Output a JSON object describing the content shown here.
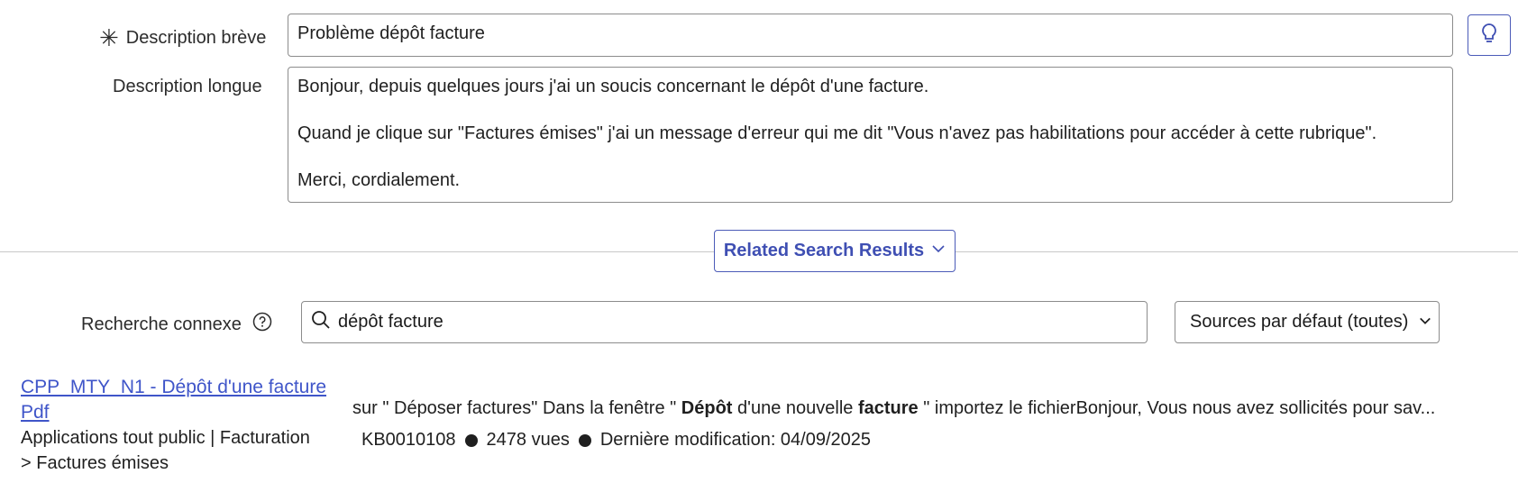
{
  "form": {
    "short_desc_label": "Description brève",
    "short_desc_value": "Problème dépôt facture",
    "long_desc_label": "Description longue",
    "long_desc_lines": [
      "Bonjour, depuis quelques jours j'ai un soucis concernant le dépôt d'une facture.",
      "Quand je clique sur \"Factures émises\" j'ai un message d'erreur qui me dit \"Vous n'avez pas habilitations pour accéder à cette rubrique\".",
      "Merci, cordialement."
    ],
    "required_marker": "✳"
  },
  "related": {
    "toggle_label": "Related Search Results",
    "search_label": "Recherche connexe",
    "search_value": "dépôt facture",
    "source_select": "Sources par défaut (toutes)"
  },
  "result": {
    "title_line1": "CPP_MTY_N1 - Dépôt d'une facture",
    "title_line2": "Pdf",
    "path_line1": "Applications tout public | Facturation",
    "path_line2": "> Factures émises",
    "snippet_pre": "sur \" Déposer factures\" Dans la fenêtre \" ",
    "snippet_bold1": "Dépôt",
    "snippet_mid": " d'une nouvelle ",
    "snippet_bold2": "facture",
    "snippet_post": " \" importez le fichierBonjour, Vous nous avez sollicités pour sav...",
    "kb_number": "KB0010108",
    "views": "2478 vues",
    "modified": "Dernière modification: 04/09/2025"
  },
  "colors": {
    "accent": "#3f4fb3",
    "border": "#8c8c8c"
  }
}
